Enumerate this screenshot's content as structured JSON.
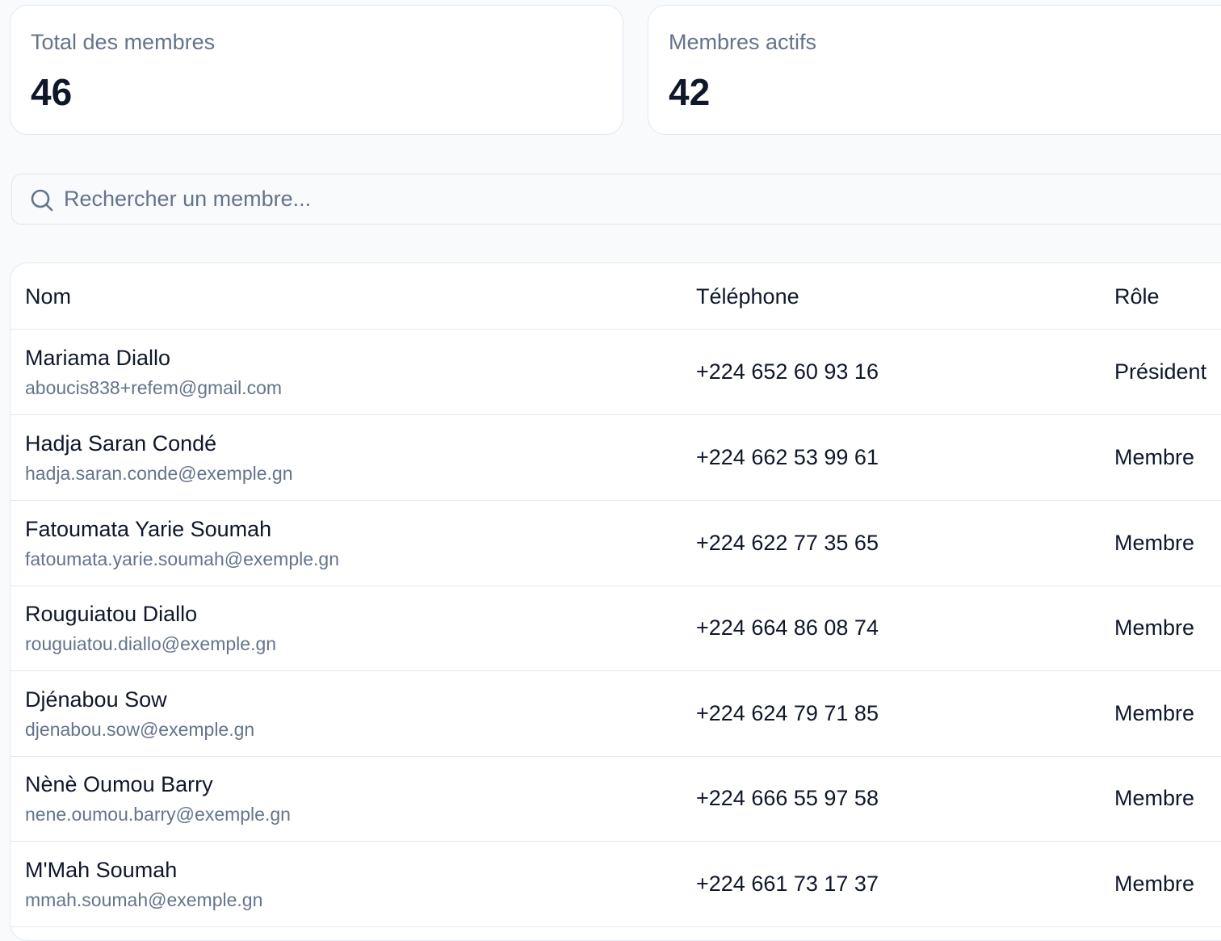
{
  "stats": {
    "total": {
      "label": "Total des membres",
      "value": "46"
    },
    "active": {
      "label": "Membres actifs",
      "value": "42"
    }
  },
  "search": {
    "icon": "search-icon",
    "placeholder": "Rechercher un membre...",
    "value": ""
  },
  "table": {
    "headers": {
      "name": "Nom",
      "phone": "Téléphone",
      "role": "Rôle"
    },
    "rows": [
      {
        "name": "Mariama Diallo",
        "email": "aboucis838+refem@gmail.com",
        "phone": "+224 652 60 93 16",
        "role": "Président"
      },
      {
        "name": "Hadja Saran Condé",
        "email": "hadja.saran.conde@exemple.gn",
        "phone": "+224 662 53 99 61",
        "role": "Membre"
      },
      {
        "name": "Fatoumata Yarie Soumah",
        "email": "fatoumata.yarie.soumah@exemple.gn",
        "phone": "+224 622 77 35 65",
        "role": "Membre"
      },
      {
        "name": "Rouguiatou Diallo",
        "email": "rouguiatou.diallo@exemple.gn",
        "phone": "+224 664 86 08 74",
        "role": "Membre"
      },
      {
        "name": "Djénabou Sow",
        "email": "djenabou.sow@exemple.gn",
        "phone": "+224 624 79 71 85",
        "role": "Membre"
      },
      {
        "name": "Nènè Oumou Barry",
        "email": "nene.oumou.barry@exemple.gn",
        "phone": "+224 666 55 97 58",
        "role": "Membre"
      },
      {
        "name": "M'Mah Soumah",
        "email": "mmah.soumah@exemple.gn",
        "phone": "+224 661 73 17 37",
        "role": "Membre"
      }
    ]
  }
}
